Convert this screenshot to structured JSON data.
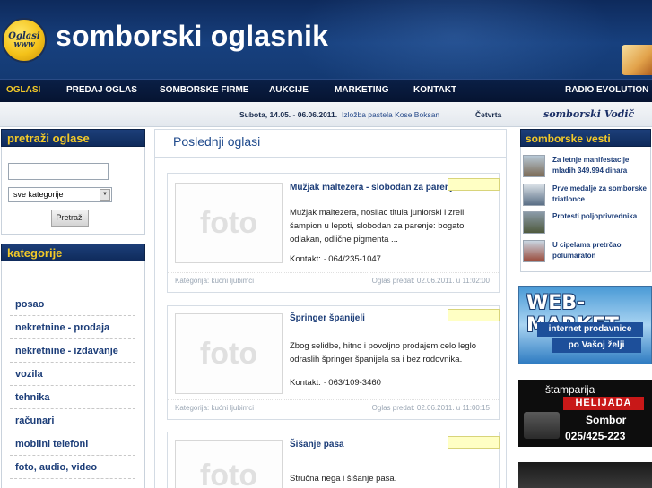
{
  "header": {
    "logo_line1": "Oglasi",
    "logo_line2": "www",
    "site_title": "somborski oglasnik"
  },
  "nav": {
    "items": [
      "OGLASI",
      "PREDAJ OGLAS",
      "SOMBORSKE FIRME",
      "AUKCIJE",
      "MARKETING",
      "KONTAKT"
    ],
    "right_item": "RADIO EVOLUTION",
    "active_color": "#f3c928"
  },
  "infobar": {
    "date": "Subota, 14.05. - 06.06.2011.",
    "event": "Izložba pastela Kose Boksan",
    "day": "Četvrta",
    "vodic": "somborski Vodič"
  },
  "search": {
    "title": "pretraži oglase",
    "select_value": "sve kategorije",
    "button_label": "Pretraži"
  },
  "categories": {
    "title": "kategorije",
    "items": [
      "posao",
      "nekretnine - prodaja",
      "nekretnine - izdavanje",
      "vozila",
      "tehnika",
      "računari",
      "mobilni telefoni",
      "foto, audio, video"
    ]
  },
  "main": {
    "title": "Poslednji oglasi",
    "photo_placeholder": "foto",
    "ads": [
      {
        "title": "Mužjak maltezera - slobodan za parenje",
        "description": "Mužjak maltezera, nosilac titula juniorski i zreli šampion u lepoti, slobodan za parenje: bogato odlakan, odlične pigmenta ...",
        "contact": "Kontakt: · 064/235-1047",
        "category": "Kategorija: kućni ljubimci",
        "date": "Oglas predat: 02.06.2011. u 11:02:00"
      },
      {
        "title": "Špringer španijeli",
        "description": "Zbog selidbe, hitno i povoljno prodajem celo leglo odraslih špringer španijela sa i bez rodovnika.",
        "contact": "Kontakt: · 063/109-3460",
        "category": "Kategorija: kućni ljubimci",
        "date": "Oglas predat: 02.06.2011. u 11:00:15"
      },
      {
        "title": "Šišanje pasa",
        "description": "Stručna nega i šišanje pasa.",
        "contact": "",
        "category": "",
        "date": ""
      }
    ]
  },
  "news": {
    "title": "somborske vesti",
    "items": [
      "Za letnje manifestacije mladih 349.994 dinara",
      "Prve medalje za somborske triatlonce",
      "Protesti poljoprivrednika",
      "U cipelama pretrčao polumaraton"
    ]
  },
  "banners": {
    "web_market_title": "WEB-MARKET",
    "web_market_line1": "internet prodavnice",
    "web_market_line2": "po Vašoj želji",
    "helijada_line1": "štamparija",
    "helijada_line2": "HELIJADA",
    "helijada_line3": "Sombor",
    "helijada_line4": "025/425-223"
  }
}
